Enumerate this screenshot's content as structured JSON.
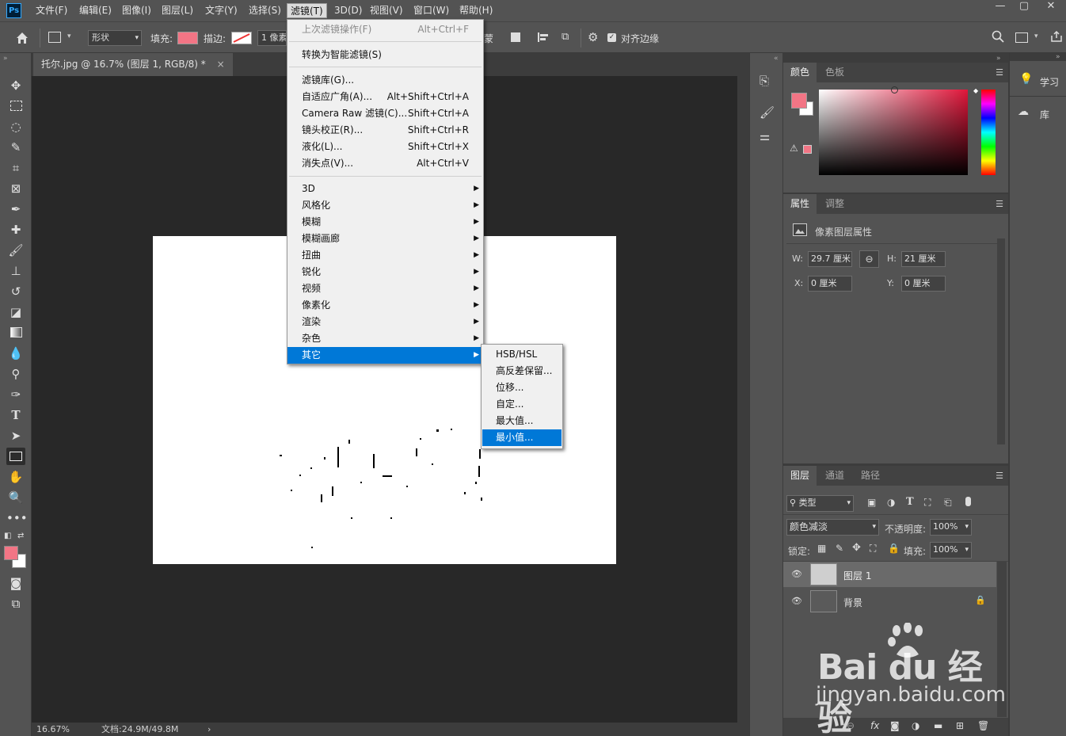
{
  "app": {
    "logo": "Ps",
    "menus": [
      "文件(F)",
      "编辑(E)",
      "图像(I)",
      "图层(L)",
      "文字(Y)",
      "选择(S)",
      "滤镜(T)",
      "3D(D)",
      "视图(V)",
      "窗口(W)",
      "帮助(H)"
    ],
    "active_menu": "滤镜(T)",
    "window_controls": [
      "—",
      "▢",
      "✕"
    ]
  },
  "options": {
    "shape_mode": "形状",
    "fill_label": "填充:",
    "fill_color": "#f27585",
    "stroke_label": "描边:",
    "stroke_width": "1 像素",
    "align_edges_label": "对齐边缘",
    "align_edges_checked": true,
    "fragment": "蒙"
  },
  "document": {
    "tab_title": "托尔.jpg @ 16.7% (图层 1, RGB/8) *",
    "close": "×",
    "zoom": "16.67%",
    "doc_info": "文档:24.9M/49.8M",
    "status_arrow": "›"
  },
  "filter_menu": {
    "last_filter": {
      "label": "上次滤镜操作(F)",
      "shortcut": "Alt+Ctrl+F"
    },
    "smart": "转换为智能滤镜(S)",
    "group2": [
      {
        "label": "滤镜库(G)...",
        "shortcut": ""
      },
      {
        "label": "自适应广角(A)...",
        "shortcut": "Alt+Shift+Ctrl+A"
      },
      {
        "label": "Camera Raw 滤镜(C)...",
        "shortcut": "Shift+Ctrl+A"
      },
      {
        "label": "镜头校正(R)...",
        "shortcut": "Shift+Ctrl+R"
      },
      {
        "label": "液化(L)...",
        "shortcut": "Shift+Ctrl+X"
      },
      {
        "label": "消失点(V)...",
        "shortcut": "Alt+Ctrl+V"
      }
    ],
    "submenus": [
      "3D",
      "风格化",
      "模糊",
      "模糊画廊",
      "扭曲",
      "锐化",
      "视频",
      "像素化",
      "渲染",
      "杂色",
      "其它"
    ],
    "highlighted": "其它"
  },
  "other_submenu": {
    "items": [
      "HSB/HSL",
      "高反差保留...",
      "位移...",
      "自定...",
      "最大值...",
      "最小值..."
    ],
    "highlighted": "最小值..."
  },
  "color_panel": {
    "tabs": [
      "颜色",
      "色板"
    ],
    "foreground": "#f27585",
    "background": "#ffffff",
    "warning": "⚠"
  },
  "properties_panel": {
    "tabs": [
      "属性",
      "调整"
    ],
    "title": "像素图层属性",
    "w_label": "W:",
    "w_value": "29.7 厘米",
    "h_label": "H:",
    "h_value": "21 厘米",
    "x_label": "X:",
    "x_value": "0 厘米",
    "y_label": "Y:",
    "y_value": "0 厘米"
  },
  "layers_panel": {
    "tabs": [
      "图层",
      "通道",
      "路径"
    ],
    "filter_kind": "类型",
    "blend_mode": "颜色减淡",
    "opacity_label": "不透明度:",
    "opacity": "100%",
    "lock_label": "锁定:",
    "fill_label": "填充:",
    "fill": "100%",
    "layers": [
      {
        "name": "图层 1",
        "selected": true,
        "visible": true,
        "locked": false
      },
      {
        "name": "背景",
        "selected": false,
        "visible": true,
        "locked": true
      }
    ],
    "footer_icons": [
      "link-icon",
      "fx-icon",
      "mask-icon",
      "adjustment-icon",
      "group-icon",
      "new-layer-icon",
      "delete-icon"
    ]
  },
  "far_right": {
    "learn": "学习",
    "library": "库"
  },
  "watermark": {
    "brand": "Bai  du 经验",
    "url": "jingyan.baidu.com"
  }
}
